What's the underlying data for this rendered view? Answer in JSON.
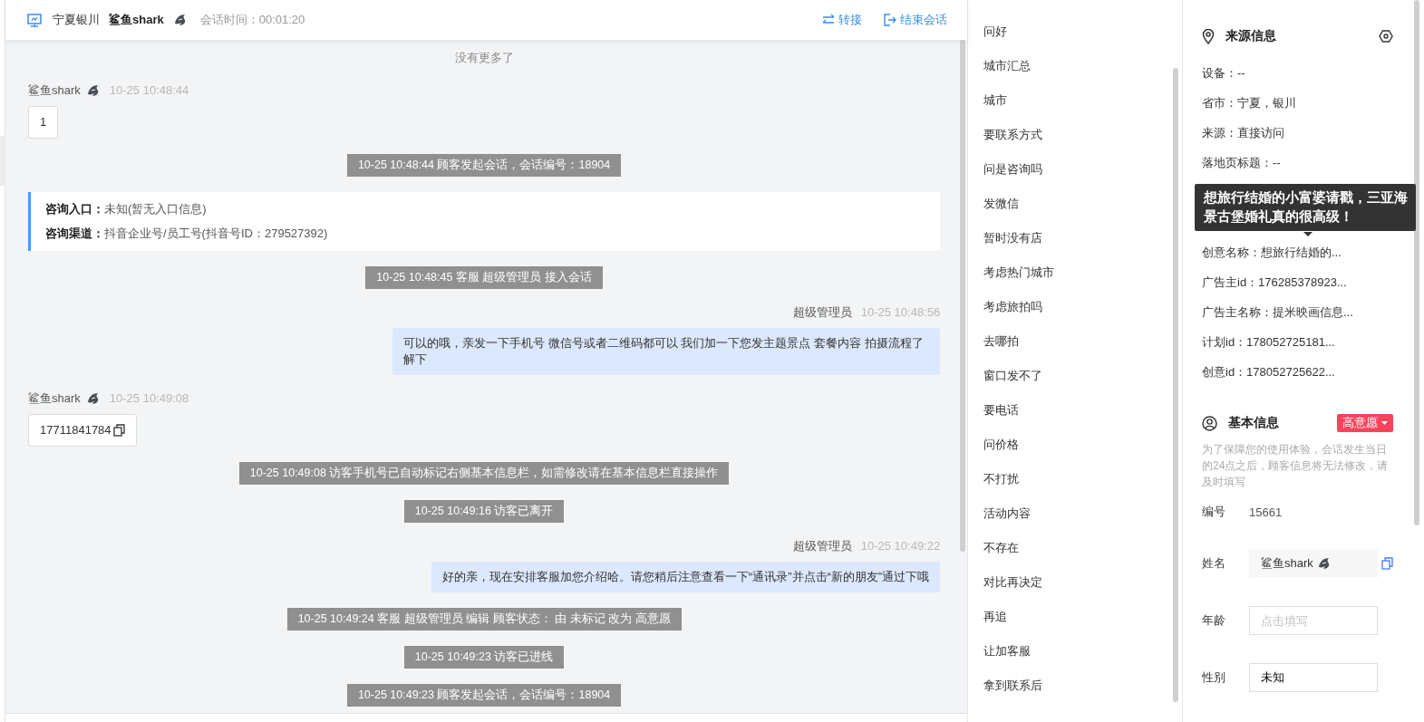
{
  "header": {
    "location": "宁夏银川",
    "visitor": "鲨鱼shark",
    "duration": "会话时间：00:01:20",
    "actions": [
      {
        "kind": "transfer",
        "label": "转接"
      },
      {
        "kind": "end",
        "label": "结束会话"
      }
    ]
  },
  "chat": {
    "messages": [
      {
        "kind": "notice",
        "text": "没有更多了"
      },
      {
        "kind": "visitor",
        "name": "鲨鱼shark",
        "time": "10-25 10:48:44",
        "text": "1",
        "copyable": false
      },
      {
        "kind": "system",
        "text": "10-25 10:48:44 顾客发起会话，会话编号：18904"
      },
      {
        "kind": "entry",
        "lines": [
          "**咨询入口：**未知(暂无入口信息)",
          "**咨询渠道：**抖音企业号/员工号(抖音号ID：279527392)"
        ]
      },
      {
        "kind": "system",
        "text": "10-25 10:48:45 客服 超级管理员 接入会话"
      },
      {
        "kind": "agent",
        "name": "超级管理员",
        "time": "10-25 10:48:56",
        "text": "可以的哦，亲发一下手机号 微信号或者二维码都可以 我们加一下您发主题景点 套餐内容 拍摄流程了解下"
      },
      {
        "kind": "visitor",
        "name": "鲨鱼shark",
        "time": "10-25 10:49:08",
        "text": "17711841784",
        "copyable": true
      },
      {
        "kind": "system",
        "text": "10-25 10:49:08 访客手机号已自动标记右侧基本信息栏，如需修改请在基本信息栏直接操作"
      },
      {
        "kind": "system",
        "text": "10-25 10:49:16 访客已离开"
      },
      {
        "kind": "agent",
        "name": "超级管理员",
        "time": "10-25 10:49:22",
        "text": "好的亲，现在安排客服加您介绍哈。请您稍后注意查看一下“通讯录”并点击“新的朋友”通过下哦"
      },
      {
        "kind": "system",
        "text": "10-25 10:49:24 客服 超级管理员 编辑 顾客状态： 由 未标记 改为 高意愿"
      },
      {
        "kind": "system",
        "text": "10-25 10:49:23 访客已进线"
      },
      {
        "kind": "system",
        "text": "10-25 10:49:23 顾客发起会话，会话编号：18904"
      }
    ]
  },
  "quick_replies": [
    "问好",
    "城市汇总",
    "城市",
    "要联系方式",
    "问是咨询吗",
    "发微信",
    "暂时没有店",
    "考虑热门城市",
    "考虑旅拍吗",
    "去哪拍",
    "窗口发不了",
    "要电话",
    "问价格",
    "不打扰",
    "活动内容",
    "不存在",
    "对比再决定",
    "再追",
    "让加客服",
    "拿到联系后"
  ],
  "source_info": {
    "title": "来源信息",
    "rows": [
      "设备：--",
      "省市：宁夏，银川",
      "来源：直接访问",
      "落地页标题：--",
      "创意名称：想旅行结婚的...",
      "广告主id：176285378923...",
      "广告主名称：提米映画信息...",
      "计划id：178052725181...",
      "创意id：178052725622..."
    ],
    "tooltip": "想旅行结婚的小富婆请戳，三亚海景古堡婚礼真的很高级！"
  },
  "basic_info": {
    "title": "基本信息",
    "intent": "高意愿",
    "hint": "为了保障您的使用体验，会话发生当日的24点之后，顾客信息将无法修改，请及时填写",
    "fields": [
      {
        "kind": "text",
        "label": "编号",
        "value": "15661"
      },
      {
        "kind": "name",
        "label": "姓名",
        "value": "鲨鱼shark"
      },
      {
        "kind": "input",
        "label": "年龄",
        "placeholder": "点击填写"
      },
      {
        "kind": "input",
        "label": "性别",
        "value": "未知"
      }
    ]
  }
}
